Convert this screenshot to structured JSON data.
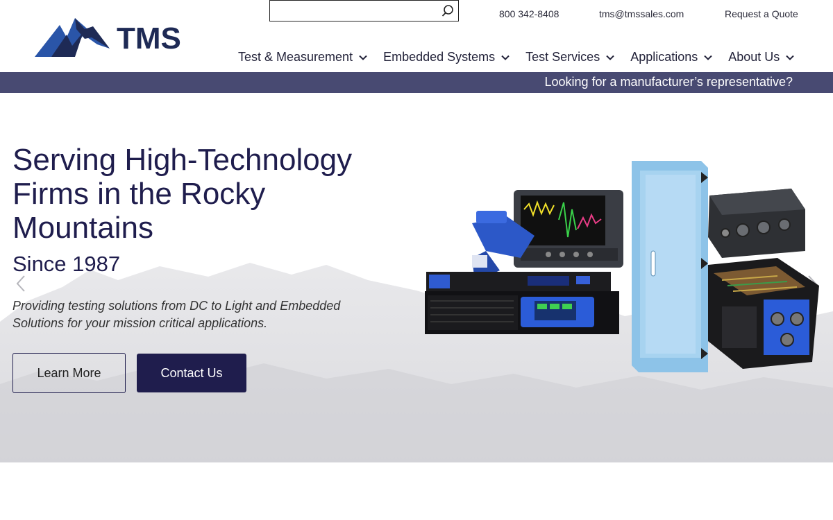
{
  "brand": {
    "name": "TMS"
  },
  "search": {
    "placeholder": "",
    "value": ""
  },
  "top_links": {
    "phone": "800 342-8408",
    "email": "tms@tmssales.com",
    "quote": "Request a Quote"
  },
  "nav": {
    "items": [
      {
        "label": "Test & Measurement"
      },
      {
        "label": "Embedded Systems"
      },
      {
        "label": "Test Services"
      },
      {
        "label": "Applications"
      },
      {
        "label": "About Us"
      }
    ]
  },
  "rep_bar": {
    "text": "Looking for a manufacturer’s representative?"
  },
  "hero": {
    "title": "Serving High-Technology Firms in the Rocky Mountains",
    "subtitle": "Since 1987",
    "description": "Providing testing solutions from DC to Light and Embedded Solutions for your mission critical applications.",
    "learn_more": "Learn More",
    "contact_us": "Contact Us"
  },
  "colors": {
    "navy": "#1f1d4d",
    "rep_bar": "#484a72",
    "logo_blue": "#2a55a8"
  }
}
